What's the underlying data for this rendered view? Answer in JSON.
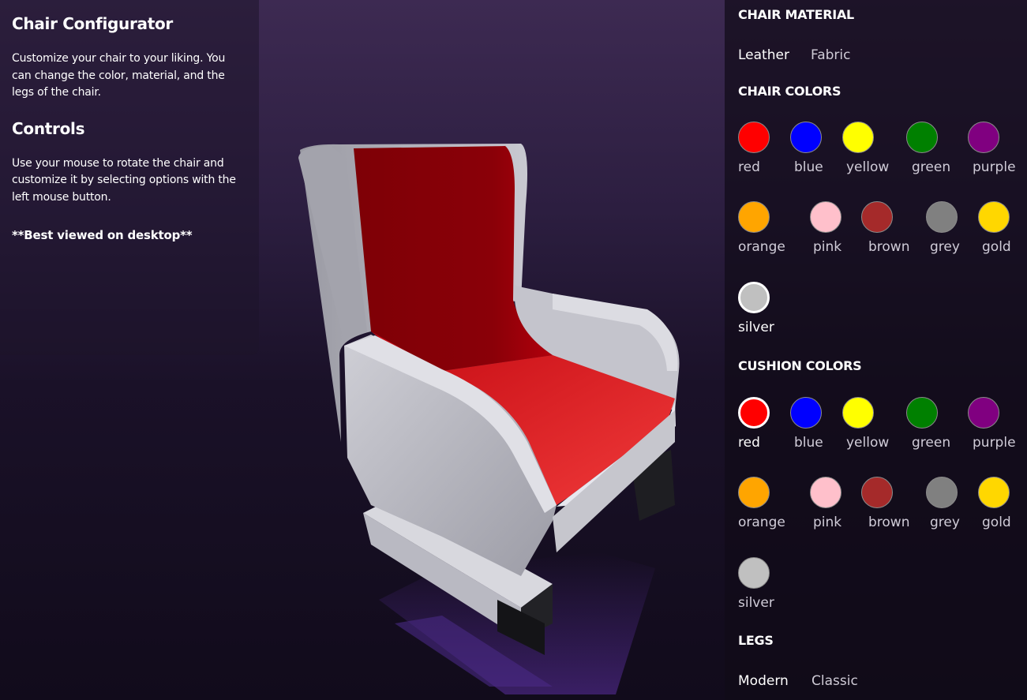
{
  "info": {
    "title": "Chair Configurator",
    "description": "Customize your chair to your liking. You can change the color, material, and the legs of the chair.",
    "controls_title": "Controls",
    "controls_text": "Use your mouse to rotate the chair and customize it by selecting options with the left mouse button.",
    "note": "**Best viewed on desktop**"
  },
  "material": {
    "title": "CHAIR MATERIAL",
    "options": [
      "Leather",
      "Fabric"
    ],
    "selected": "Leather"
  },
  "chair_colors": {
    "title": "CHAIR COLORS",
    "selected": "silver",
    "swatches": [
      {
        "name": "red",
        "hex": "#ff0000"
      },
      {
        "name": "blue",
        "hex": "#0000ff"
      },
      {
        "name": "yellow",
        "hex": "#ffff00"
      },
      {
        "name": "green",
        "hex": "#008000"
      },
      {
        "name": "purple",
        "hex": "#800080"
      },
      {
        "name": "orange",
        "hex": "#ffa500"
      },
      {
        "name": "pink",
        "hex": "#ffc0cb"
      },
      {
        "name": "brown",
        "hex": "#a52a2a"
      },
      {
        "name": "grey",
        "hex": "#808080"
      },
      {
        "name": "gold",
        "hex": "#ffd700"
      },
      {
        "name": "silver",
        "hex": "#c0c0c0"
      }
    ]
  },
  "cushion_colors": {
    "title": "CUSHION COLORS",
    "selected": "red",
    "swatches": [
      {
        "name": "red",
        "hex": "#ff0000"
      },
      {
        "name": "blue",
        "hex": "#0000ff"
      },
      {
        "name": "yellow",
        "hex": "#ffff00"
      },
      {
        "name": "green",
        "hex": "#008000"
      },
      {
        "name": "purple",
        "hex": "#800080"
      },
      {
        "name": "orange",
        "hex": "#ffa500"
      },
      {
        "name": "pink",
        "hex": "#ffc0cb"
      },
      {
        "name": "brown",
        "hex": "#a52a2a"
      },
      {
        "name": "grey",
        "hex": "#808080"
      },
      {
        "name": "gold",
        "hex": "#ffd700"
      },
      {
        "name": "silver",
        "hex": "#c0c0c0"
      }
    ]
  },
  "legs": {
    "title": "LEGS",
    "options": [
      "Modern",
      "Classic"
    ],
    "selected": "Modern"
  }
}
